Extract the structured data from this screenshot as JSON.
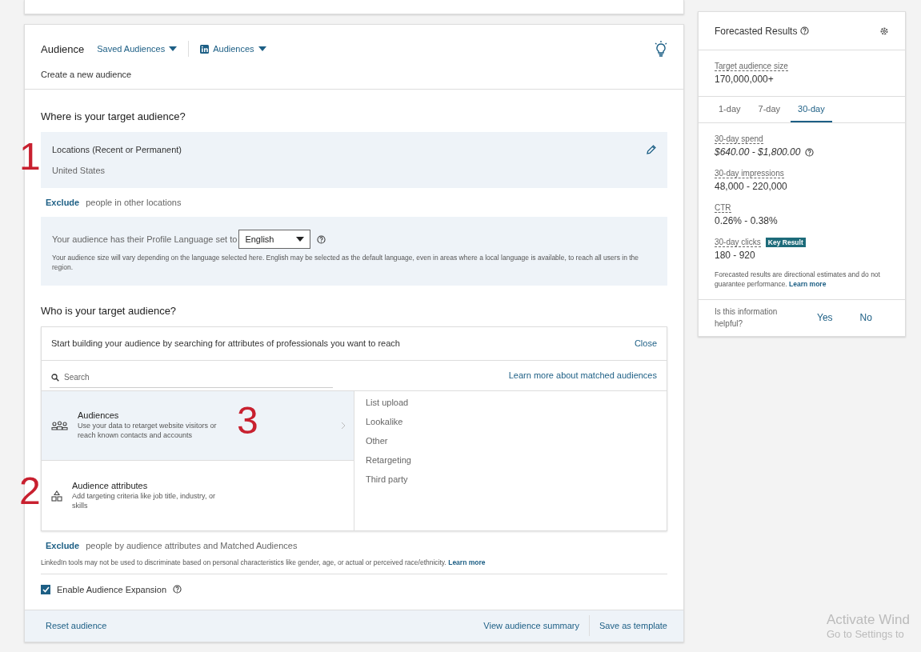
{
  "audience_card": {
    "title": "Audience",
    "saved_audiences": "Saved Audiences",
    "audiences_menu": "Audiences",
    "subtitle": "Create a new audience",
    "where": {
      "heading": "Where is your target audience?",
      "locations_label": "Locations (Recent or Permanent)",
      "locations_value": "United States",
      "exclude_link": "Exclude",
      "exclude_text": "people in other locations",
      "language_prompt": "Your audience has their Profile Language set to",
      "language_value": "English",
      "language_note": "Your audience size will vary depending on the language selected here. English may be selected as the default language, even in areas where a local language is available, to reach all users in the region."
    },
    "who": {
      "heading": "Who is your target audience?",
      "builder_prompt": "Start building your audience by searching for attributes of professionals you want to reach",
      "close": "Close",
      "search_placeholder": "Search",
      "learn_matched": "Learn more about matched audiences",
      "categories": [
        {
          "kind": "people",
          "title": "Audiences",
          "description": "Use your data to retarget website visitors or reach known contacts and accounts",
          "selected": true
        },
        {
          "kind": "shapes",
          "title": "Audience attributes",
          "description": "Add targeting criteria like job title, industry, or skills",
          "selected": false
        }
      ],
      "subcategories": [
        "List upload",
        "Lookalike",
        "Other",
        "Retargeting",
        "Third party"
      ],
      "exclude_link": "Exclude",
      "exclude_text": "people by audience attributes and Matched Audiences",
      "disclaimer": "LinkedIn tools may not be used to discriminate based on personal characteristics like gender, age, or actual or perceived race/ethnicity.",
      "disclaimer_link": "Learn more",
      "expansion": {
        "label": "Enable Audience Expansion",
        "checked": true
      }
    },
    "footer": {
      "reset": "Reset audience",
      "summary": "View audience summary",
      "template": "Save as template"
    }
  },
  "forecast": {
    "title": "Forecasted Results",
    "size_label": "Target audience size",
    "size_value": "170,000,000+",
    "tabs": [
      {
        "label": "1-day",
        "selected": false
      },
      {
        "label": "7-day",
        "selected": false
      },
      {
        "label": "30-day",
        "selected": true
      }
    ],
    "metrics": [
      {
        "label": "30-day spend",
        "value": "$640.00 - $1,800.00",
        "kind": "spend"
      },
      {
        "label": "30-day impressions",
        "value": "48,000 - 220,000",
        "kind": "plain"
      },
      {
        "label": "CTR",
        "value": "0.26% - 0.38%",
        "kind": "plain"
      },
      {
        "label": "30-day clicks",
        "value": "180 - 920",
        "kind": "key",
        "badge": "Key Result"
      }
    ],
    "note": "Forecasted results are directional estimates and do not guarantee performance.",
    "note_link": "Learn more",
    "feedback": {
      "question": "Is this information helpful?",
      "yes": "Yes",
      "no": "No"
    }
  },
  "annotations": [
    "1",
    "2",
    "3"
  ],
  "os_watermark": [
    "Activate Wind",
    "Go to Settings to"
  ]
}
